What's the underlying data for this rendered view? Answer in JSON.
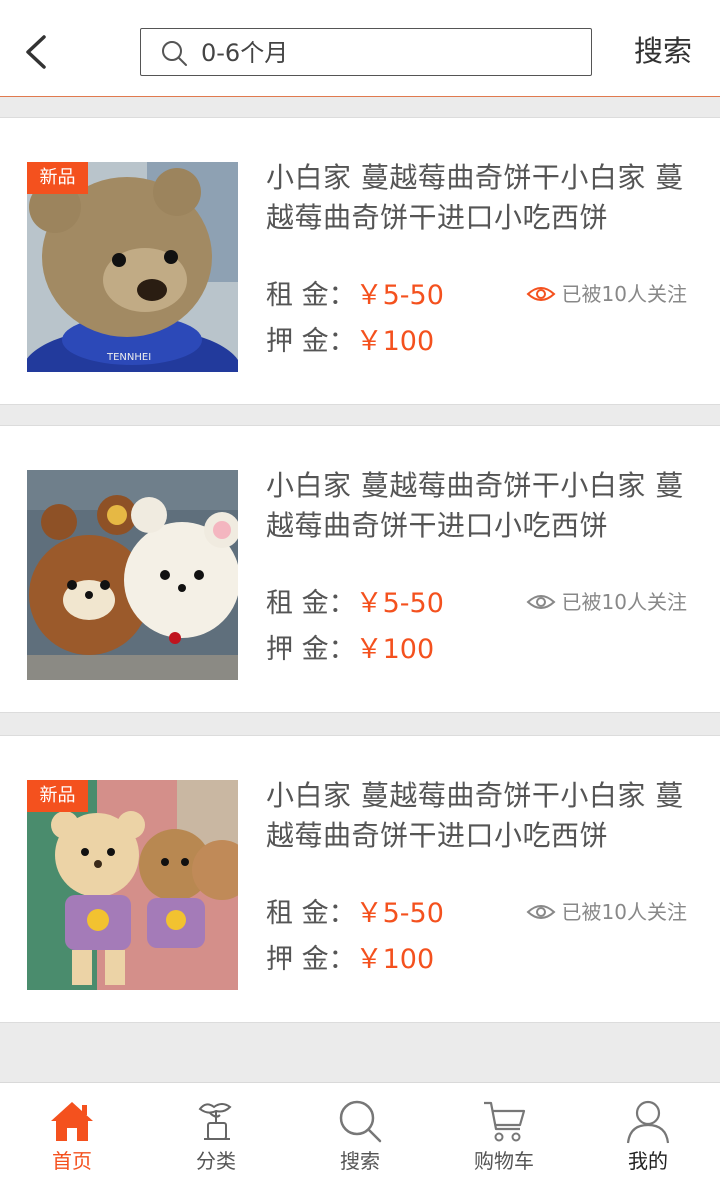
{
  "header": {
    "back_icon": "chevron-left-icon",
    "search_placeholder": "0-6个月",
    "search_button": "搜索"
  },
  "colors": {
    "accent": "#f4511e",
    "text": "#555555",
    "muted": "#888888",
    "background": "#ebebeb"
  },
  "products": [
    {
      "is_new": true,
      "tag": "新品",
      "title": "小白家 蔓越莓曲奇饼干小白家 蔓越莓曲奇饼干进口小吃西饼",
      "rent_label": "租 金：",
      "rent": "￥5-50",
      "deposit_label": "押 金：",
      "deposit": "￥100",
      "followers": "已被10人关注",
      "image": "brown-teddy-bear-blue-shirt"
    },
    {
      "is_new": false,
      "tag": "",
      "title": "小白家 蔓越莓曲奇饼干小白家 蔓越莓曲奇饼干进口小吃西饼",
      "rent_label": "租 金：",
      "rent": "￥5-50",
      "deposit_label": "押 金：",
      "deposit": "￥100",
      "followers": "已被10人关注",
      "image": "two-bears-brown-white"
    },
    {
      "is_new": true,
      "tag": "新品",
      "title": "小白家 蔓越莓曲奇饼干小白家 蔓越莓曲奇饼干进口小吃西饼",
      "rent_label": "租 金：",
      "rent": "￥5-50",
      "deposit_label": "押 金：",
      "deposit": "￥100",
      "followers": "已被10人关注",
      "image": "bears-purple-shirts"
    }
  ],
  "tabbar": [
    {
      "label": "首页",
      "icon": "home-icon",
      "active": true
    },
    {
      "label": "分类",
      "icon": "category-icon",
      "active": false
    },
    {
      "label": "搜索",
      "icon": "search-icon",
      "active": false
    },
    {
      "label": "购物车",
      "icon": "cart-icon",
      "active": false
    },
    {
      "label": "我的",
      "icon": "user-icon",
      "active": false
    }
  ]
}
